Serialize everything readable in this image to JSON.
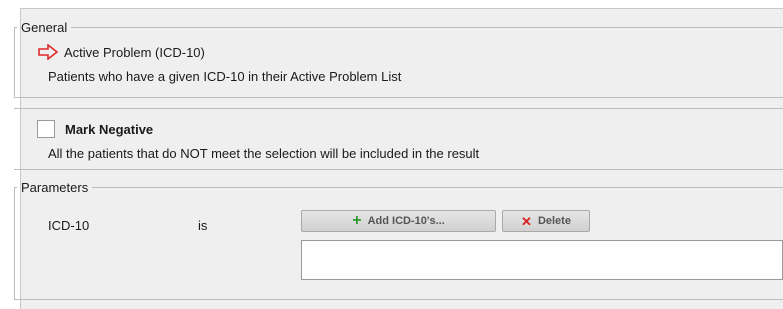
{
  "general": {
    "legend": "General",
    "criterion_icon": "arrow-right-outline-icon",
    "criterion_title": "Active Problem (ICD-10)",
    "criterion_description": "Patients who have a given ICD-10 in their Active Problem List"
  },
  "mark_negative": {
    "label": "Mark Negative",
    "checked": false,
    "description": "All the patients that do NOT meet the selection will be included in the result"
  },
  "parameters": {
    "legend": "Parameters",
    "rows": [
      {
        "name": "ICD-10",
        "operator": "is",
        "add_label": "Add ICD-10's...",
        "delete_label": "Delete",
        "values": []
      }
    ]
  },
  "colors": {
    "panel_bg": "#efefef",
    "arrow_red": "#e0282a",
    "add_green": "#2e9a2e",
    "delete_red": "#d92020"
  }
}
